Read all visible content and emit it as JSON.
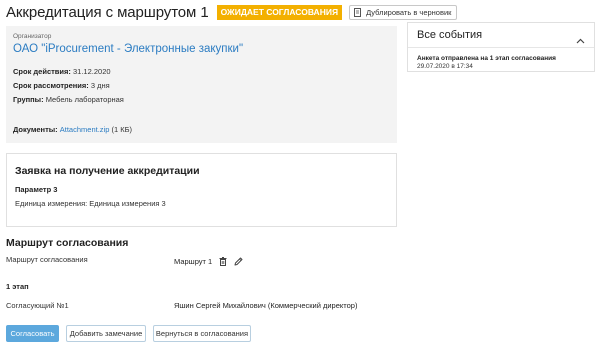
{
  "header": {
    "title": "Аккредитация с маршрутом 1",
    "status": "ОЖИДАЕТ СОГЛАСОВАНИЯ",
    "duplicate_label": "Дублировать в черновик"
  },
  "organization": {
    "label": "Организатор",
    "name": "ОАО \"iProcurement - Электронные закупки\"",
    "validity_label": "Срок действия:",
    "validity_value": "31.12.2020",
    "review_label": "Срок рассмотрения:",
    "review_value": "3 дня",
    "groups_label": "Группы:",
    "groups_value": "Мебель лабораторная",
    "documents_label": "Документы:",
    "document_name": "Attachment.zip",
    "document_size": "(1 КБ)"
  },
  "request": {
    "title": "Заявка на получение аккредитации",
    "param_title": "Параметр 3",
    "param_unit": "Единица измерения: Единица измерения 3"
  },
  "route": {
    "title": "Маршрут согласования",
    "label": "Маршрут согласования",
    "value": "Маршрут 1",
    "stage_title": "1 этап",
    "approver_label": "Согласующий №1",
    "approver_value": "Яшин Сергей Михайлович (Коммерческий директор)"
  },
  "actions": {
    "approve": "Согласовать",
    "add_remark": "Добавить замечание",
    "return": "Вернуться в согласования"
  },
  "events": {
    "title": "Все события",
    "items": [
      {
        "text": "Анкета отправлена на 1 этап согласования",
        "date": "29.07.2020 в 17:34"
      }
    ]
  },
  "colors": {
    "status_badge": "#f3b000",
    "link": "#2b7cc2",
    "primary_button": "#5ca8dd"
  },
  "icons": {
    "duplicate": "document-copy-icon",
    "delete": "trash-icon",
    "edit": "pencil-icon",
    "collapse": "chevron-up-icon"
  }
}
